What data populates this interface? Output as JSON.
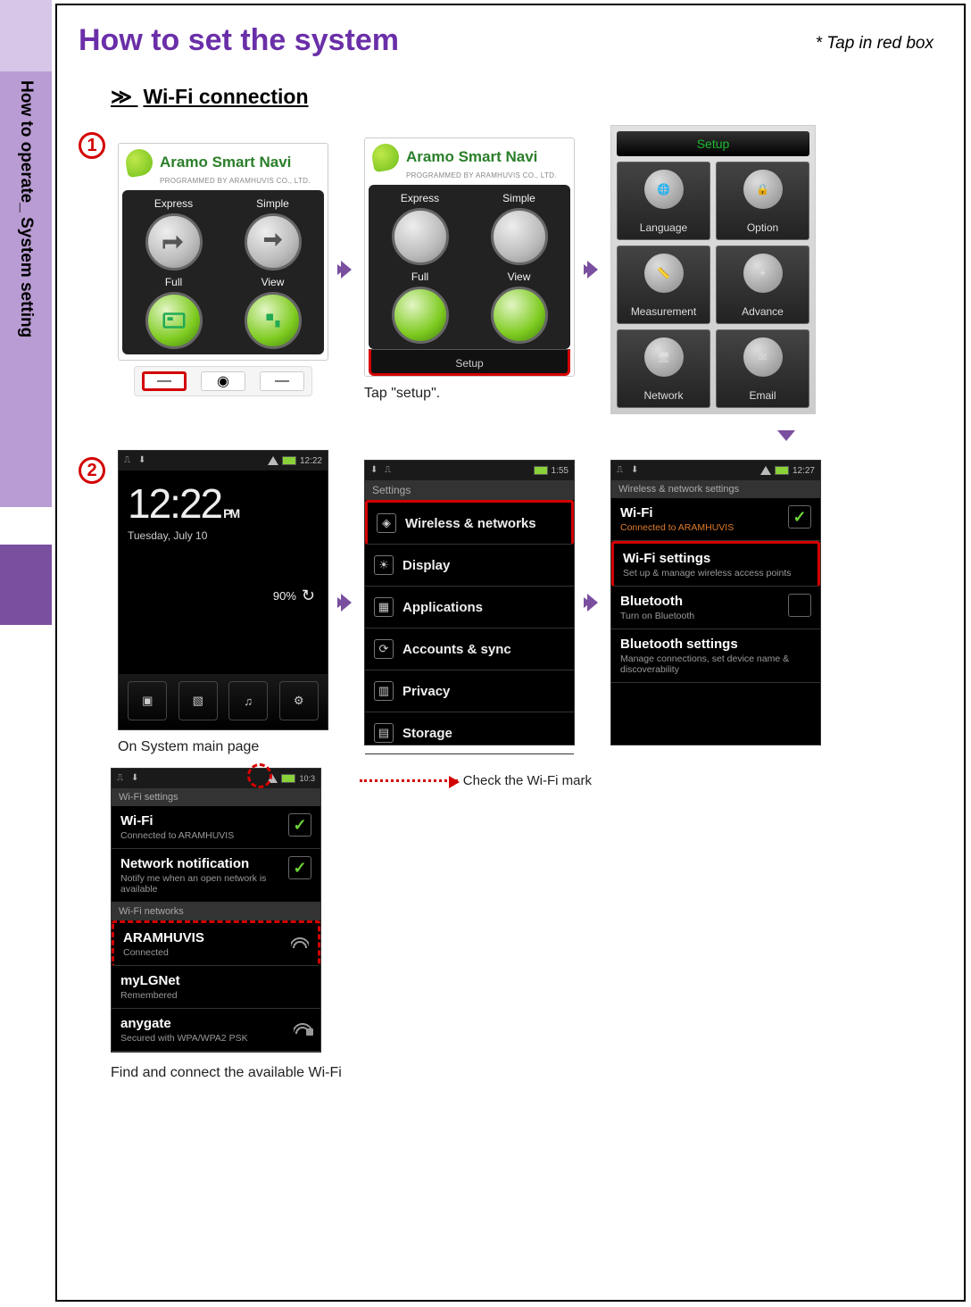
{
  "sidebar_label": "How to operate_ System setting",
  "page_title": "How to set the system",
  "hint": "* Tap in red box",
  "subsection": "Wi-Fi connection",
  "subsection_prefix": "≫ ",
  "aramo": {
    "title": "Aramo Smart Navi",
    "subtitle": "PROGRAMMED BY ARAMHUVIS CO., LTD.",
    "buttons": [
      "Express",
      "Simple",
      "Full",
      "View"
    ],
    "setup_label": "Setup"
  },
  "caption_setup": "Tap \"setup\".",
  "setup_panel": {
    "title": "Setup",
    "items": [
      "Language",
      "Option",
      "Measurement",
      "Advance",
      "Network",
      "Email"
    ]
  },
  "home": {
    "time": "12:22",
    "time_display": "12:22",
    "ampm": "PM",
    "date": "Tuesday, July 10",
    "battery": "90%",
    "statusbar_time": "12:22"
  },
  "caption_home": "On System main page",
  "settings": {
    "statusbar_time": "1:55",
    "header": "Settings",
    "items": [
      "Wireless & networks",
      "Display",
      "Applications",
      "Accounts & sync",
      "Privacy",
      "Storage"
    ]
  },
  "wireless": {
    "statusbar_time": "12:27",
    "header": "Wireless & network settings",
    "wifi_title": "Wi-Fi",
    "wifi_sub": "Connected to ARAMHUVIS",
    "wifi_settings_title": "Wi-Fi settings",
    "wifi_settings_sub": "Set up & manage wireless access points",
    "bt_title": "Bluetooth",
    "bt_sub": "Turn on Bluetooth",
    "bt_settings_title": "Bluetooth settings",
    "bt_settings_sub": "Manage connections, set device name & discoverability"
  },
  "wifi_settings_panel": {
    "header": "Wi-Fi settings",
    "wifi_title": "Wi-Fi",
    "wifi_sub": "Connected to ARAMHUVIS",
    "notif_title": "Network notification",
    "notif_sub": "Notify me when an open network is available",
    "section": "Wi-Fi networks",
    "nets": [
      {
        "name": "ARAMHUVIS",
        "sub": "Connected"
      },
      {
        "name": "myLGNet",
        "sub": "Remembered"
      },
      {
        "name": "anygate",
        "sub": "Secured with WPA/WPA2 PSK"
      }
    ]
  },
  "caption_wifi_mark": "Check the Wi-Fi mark",
  "caption_connect": "Find and connect the available Wi-Fi"
}
